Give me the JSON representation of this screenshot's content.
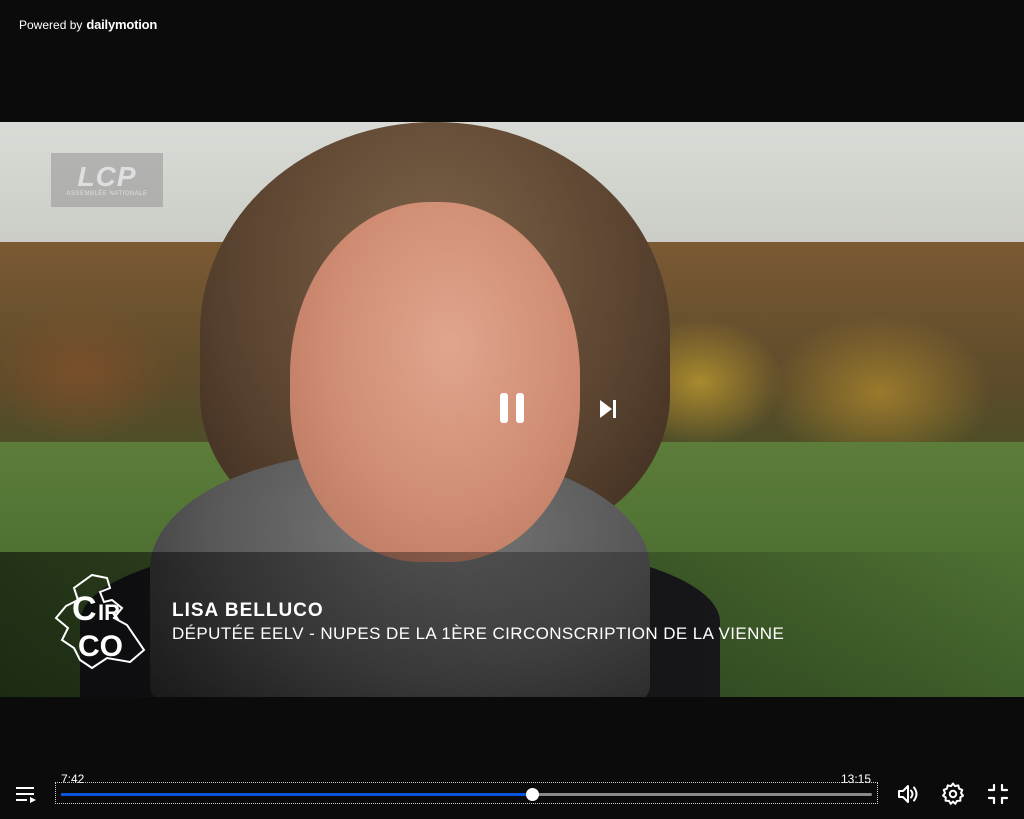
{
  "header": {
    "powered_by": "Powered by",
    "brand": "dailymotion"
  },
  "video": {
    "channel_logo_text": "LCP",
    "channel_logo_subtext": "ASSEMBLÉE NATIONALE",
    "program_logo_text": "CIRCO",
    "lower_third_name": "LISA BELLUCO",
    "lower_third_role": "DÉPUTÉE EELV - NUPES DE LA 1ÈRE CIRCONSCRIPTION DE LA VIENNE"
  },
  "controls": {
    "current_time": "7:42",
    "total_time": "13:15",
    "progress_fraction": 0.581,
    "accent_color": "#0a55e0",
    "icons": {
      "playlist": "playlist-icon",
      "pause": "pause-icon",
      "next": "skip-next-icon",
      "volume": "volume-icon",
      "settings": "gear-icon",
      "exit_fullscreen": "exit-fullscreen-icon"
    }
  }
}
